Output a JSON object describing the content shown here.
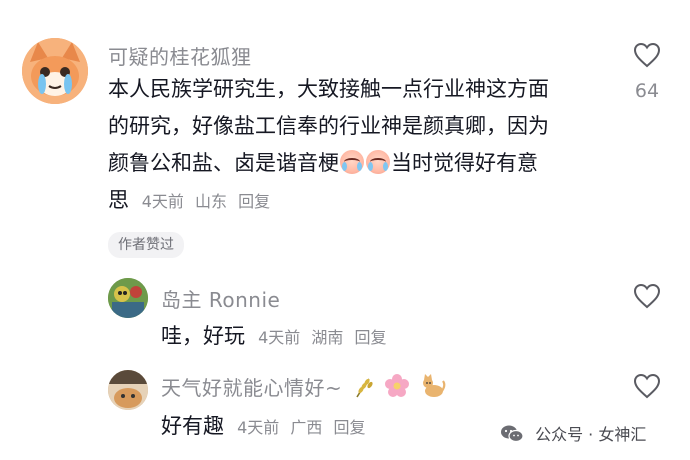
{
  "comments": [
    {
      "username": "可疑的桂花狐狸",
      "lines": [
        "本人民族学研究生，大致接触一点行业神这方面",
        "的研究，好像盐工信奉的行业神是颜真卿，因为",
        "颜鲁公和盐、卤是谐音梗",
        "当时觉得好有意",
        "思"
      ],
      "time": "4天前",
      "location": "山东",
      "reply_label": "回复",
      "like_count": "64",
      "author_badge": "作者赞过",
      "avatar_icon": "orange-fox-cartoon-avatar",
      "inline_emoji": "crying-laughing-face-icon"
    },
    {
      "username": "岛主 Ronnie",
      "text": "哇，好玩",
      "time": "4天前",
      "location": "湖南",
      "reply_label": "回复",
      "avatar_icon": "cartoon-illustration-avatar"
    },
    {
      "username": "天气好就能心情好~",
      "username_emojis": [
        "rice-ear-icon",
        "pink-flower-icon",
        "cat-icon"
      ],
      "text": "好有趣",
      "time": "4天前",
      "location": "广西",
      "reply_label": "回复",
      "avatar_icon": "cat-photo-avatar"
    }
  ],
  "watermark": {
    "text": "公众号 · 女神汇",
    "icon": "wechat-icon"
  },
  "colors": {
    "username": "#8a8b91",
    "body_text": "#161823",
    "meta": "#8a8b91",
    "badge_bg": "#f2f2f4"
  }
}
